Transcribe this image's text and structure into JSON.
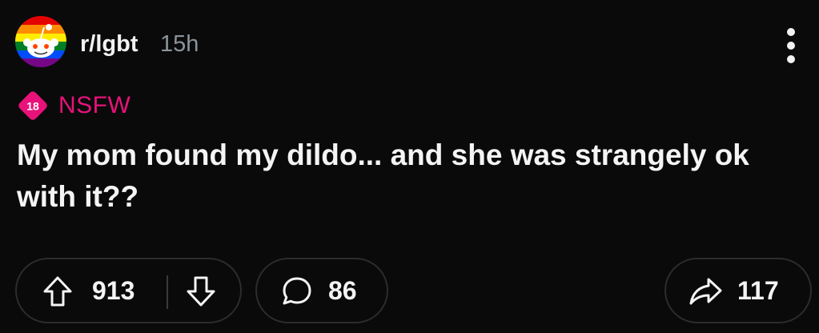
{
  "post": {
    "subreddit": "r/lgbt",
    "age": "15h",
    "nsfw_badge": "18",
    "nsfw_label": "NSFW",
    "title": "My mom found my dildo... and she was strangely ok with it??"
  },
  "actions": {
    "upvotes": "913",
    "comments": "86",
    "shares": "117"
  },
  "colors": {
    "background": "#0a0a0a",
    "nsfw": "#e8127a",
    "muted": "#8a9499"
  },
  "icons": [
    "subreddit-avatar",
    "more-options-icon",
    "nsfw-icon",
    "upvote-icon",
    "downvote-icon",
    "comment-icon",
    "share-icon"
  ]
}
